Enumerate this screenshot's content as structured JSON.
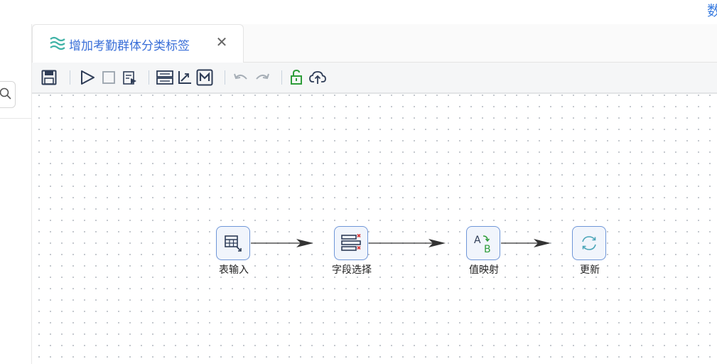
{
  "topbar": {
    "cut_text": "数"
  },
  "tab": {
    "title": "增加考勤群体分类标签",
    "close_glyph": "✕"
  },
  "toolbar": {
    "buttons": [
      "save-icon",
      "run-icon",
      "stop-icon",
      "preview-icon",
      "layout-icon",
      "align-icon",
      "m-icon",
      "undo-icon",
      "redo-icon",
      "unlock-icon",
      "upload-cloud-icon"
    ]
  },
  "colors": {
    "accent": "#3a6fd8",
    "node_border": "#6f96d8",
    "node_fill": "#f1f5fc",
    "unlock_green": "#2e9d3a",
    "edge": "#333333"
  },
  "nodes": [
    {
      "id": "table-input",
      "label": "表输入",
      "icon": "table-input-icon"
    },
    {
      "id": "field-select",
      "label": "字段选择",
      "icon": "field-select-icon"
    },
    {
      "id": "value-map",
      "label": "值映射",
      "icon": "value-map-icon",
      "glyph_a": "A",
      "glyph_b": "B"
    },
    {
      "id": "update",
      "label": "更新",
      "icon": "refresh-icon"
    }
  ]
}
